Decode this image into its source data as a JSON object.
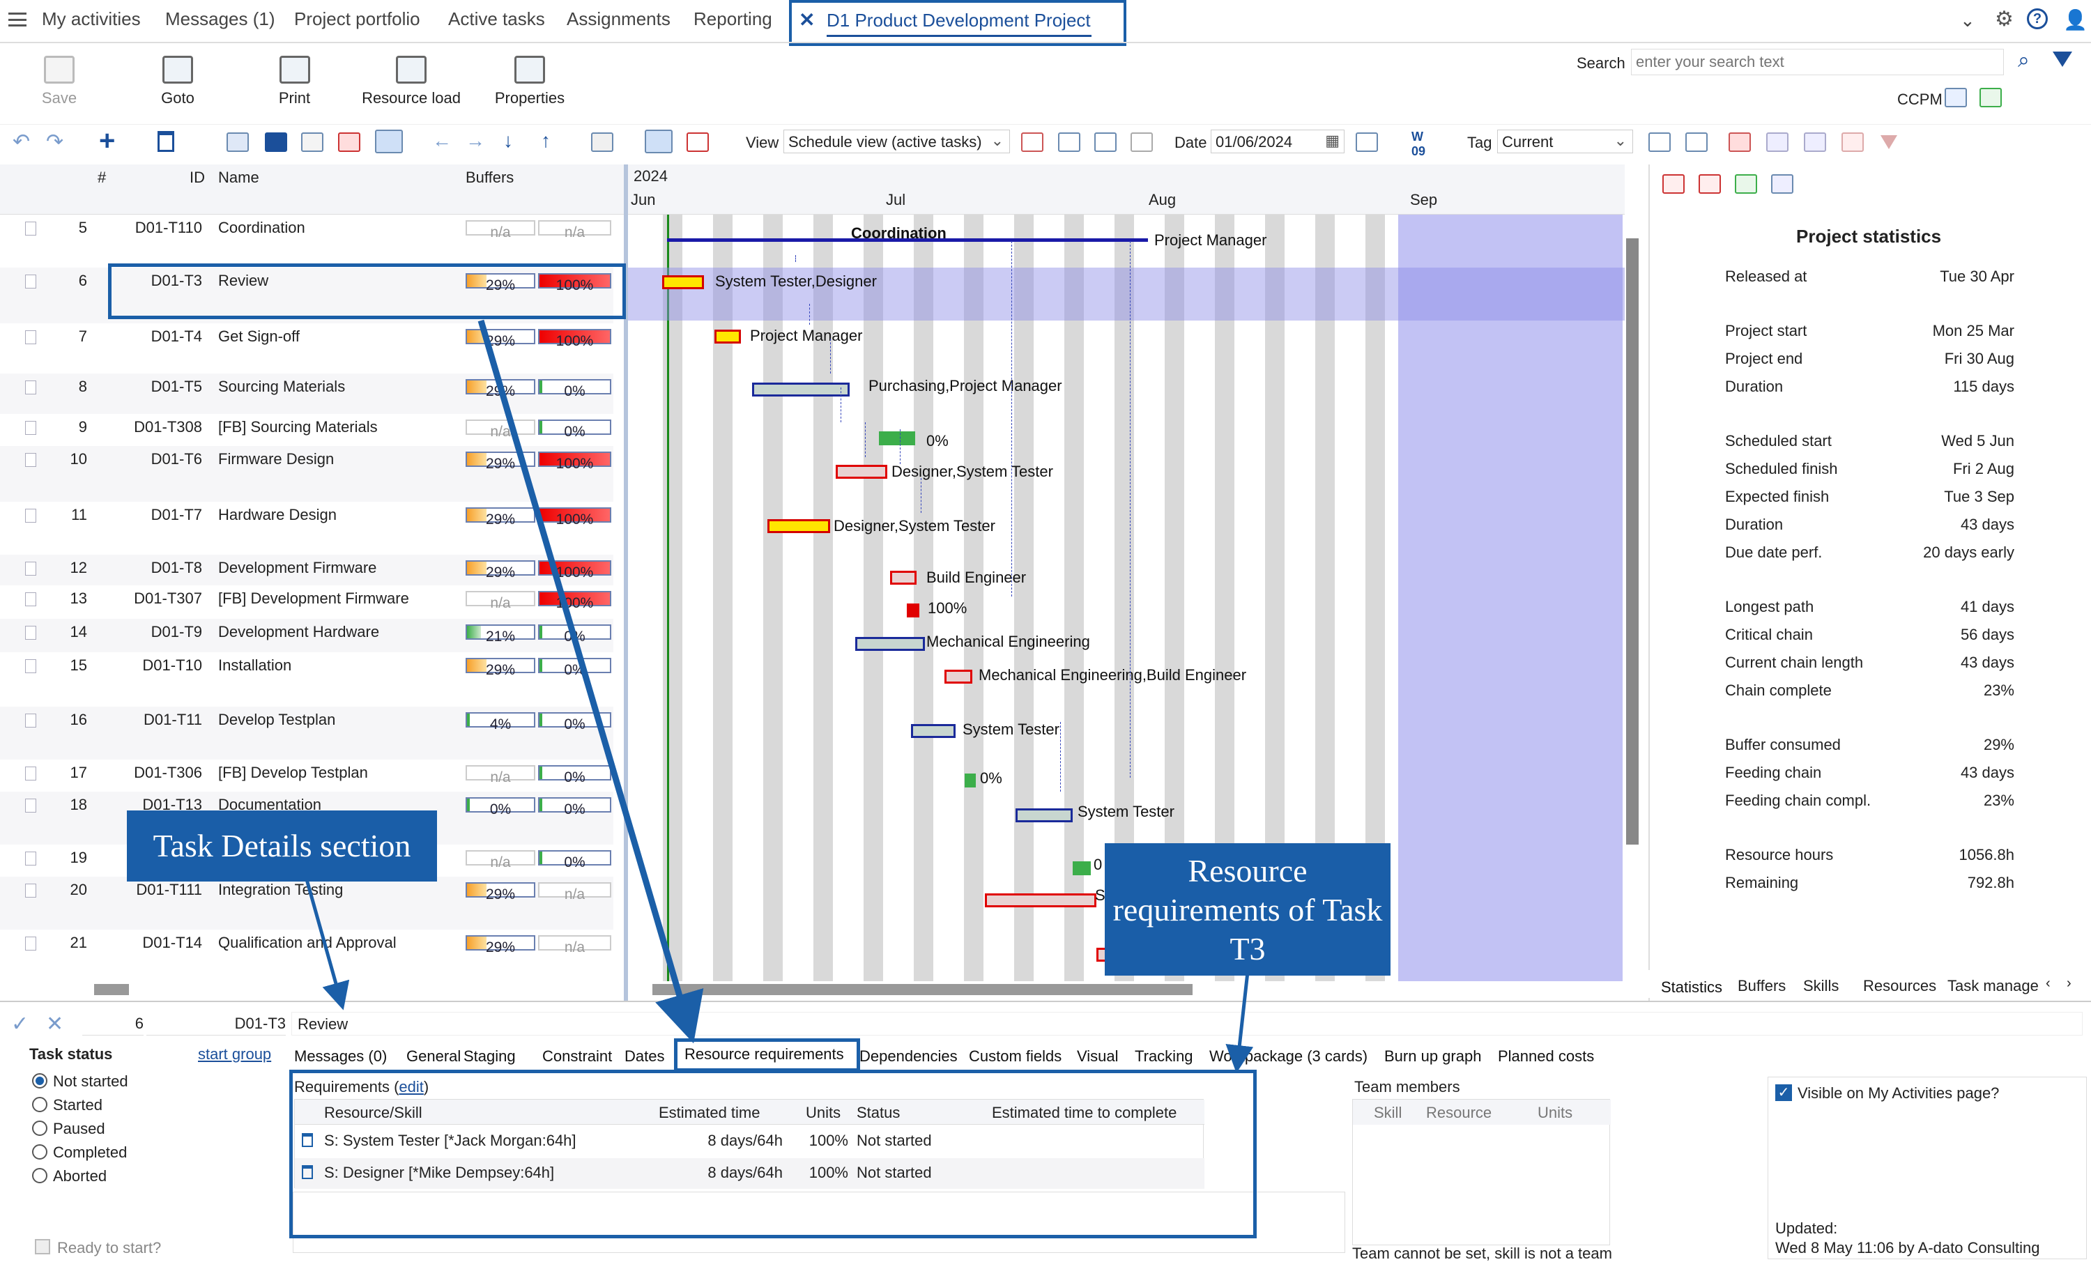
{
  "nav": {
    "tabs": [
      "My activities",
      "Messages (1)",
      "Project portfolio",
      "Active tasks",
      "Assignments",
      "Reporting"
    ],
    "active_tab": "D1 Product Development Project"
  },
  "search": {
    "label": "Search",
    "placeholder": "enter your search text"
  },
  "ccpm_label": "CCPM",
  "toolbar": {
    "save": "Save",
    "goto": "Goto",
    "print": "Print",
    "resource_load": "Resource load",
    "properties": "Properties"
  },
  "toolbar2": {
    "view_label": "View",
    "view_value": "Schedule view (active tasks)",
    "date_label": "Date",
    "date_value": "01/06/2024",
    "tag_label": "Tag",
    "tag_value": "Current"
  },
  "grid": {
    "headers": {
      "num": "#",
      "id": "ID",
      "name": "Name",
      "buffers": "Buffers"
    },
    "rows": [
      {
        "num": "5",
        "id": "D01-T110",
        "name": "Coordination",
        "b1": "n/a",
        "b2": "n/a"
      },
      {
        "num": "6",
        "id": "D01-T3",
        "name": "Review",
        "b1": "29%",
        "b2": "100%"
      },
      {
        "num": "7",
        "id": "D01-T4",
        "name": "Get Sign-off",
        "b1": "29%",
        "b2": "100%"
      },
      {
        "num": "8",
        "id": "D01-T5",
        "name": "Sourcing Materials",
        "b1": "29%",
        "b2": "0%"
      },
      {
        "num": "9",
        "id": "D01-T308",
        "name": "[FB]  Sourcing Materials",
        "b1": "n/a",
        "b2": "0%"
      },
      {
        "num": "10",
        "id": "D01-T6",
        "name": "Firmware Design",
        "b1": "29%",
        "b2": "100%"
      },
      {
        "num": "11",
        "id": "D01-T7",
        "name": "Hardware Design",
        "b1": "29%",
        "b2": "100%"
      },
      {
        "num": "12",
        "id": "D01-T8",
        "name": "Development Firmware",
        "b1": "29%",
        "b2": "100%"
      },
      {
        "num": "13",
        "id": "D01-T307",
        "name": "[FB]  Development Firmware",
        "b1": "n/a",
        "b2": "100%"
      },
      {
        "num": "14",
        "id": "D01-T9",
        "name": "Development Hardware",
        "b1": "21%",
        "b2": "0%"
      },
      {
        "num": "15",
        "id": "D01-T10",
        "name": "Installation",
        "b1": "29%",
        "b2": "0%"
      },
      {
        "num": "16",
        "id": "D01-T11",
        "name": "Develop Testplan",
        "b1": "4%",
        "b2": "0%"
      },
      {
        "num": "17",
        "id": "D01-T306",
        "name": "[FB]  Develop Testplan",
        "b1": "n/a",
        "b2": "0%"
      },
      {
        "num": "18",
        "id": "D01-T13",
        "name": "Documentation",
        "b1": "0%",
        "b2": "0%"
      },
      {
        "num": "19",
        "id": "",
        "name": "",
        "b1": "n/a",
        "b2": "0%"
      },
      {
        "num": "20",
        "id": "D01-T111",
        "name": "Integration Testing",
        "b1": "29%",
        "b2": "n/a"
      },
      {
        "num": "21",
        "id": "D01-T14",
        "name": "Qualification and Approval",
        "b1": "29%",
        "b2": "n/a"
      }
    ]
  },
  "gantt": {
    "year": "2024",
    "months": [
      "Jun",
      "Jul",
      "Aug",
      "Sep"
    ],
    "summary_title": "Coordination",
    "labels": [
      "Project Manager",
      "System Tester,Designer",
      "Project Manager",
      "Purchasing,Project Manager",
      "0%",
      "Designer,System Tester",
      "Designer,System Tester",
      "Build Engineer",
      "100%",
      "Mechanical Engineering",
      "Mechanical Engineering,Build Engineer",
      "System Tester",
      "0%",
      "System Tester",
      "0",
      "S"
    ]
  },
  "stats": {
    "title": "Project statistics",
    "items": [
      {
        "label": "Released at",
        "value": "Tue 30 Apr"
      },
      {
        "label": "Project start",
        "value": "Mon 25 Mar"
      },
      {
        "label": "Project end",
        "value": "Fri 30 Aug"
      },
      {
        "label": "Duration",
        "value": "115 days"
      },
      {
        "label": "Scheduled start",
        "value": "Wed 5 Jun"
      },
      {
        "label": "Scheduled finish",
        "value": "Fri 2 Aug"
      },
      {
        "label": "Expected finish",
        "value": "Tue 3 Sep"
      },
      {
        "label": "Duration",
        "value": "43 days"
      },
      {
        "label": "Due date perf.",
        "value": "20 days early"
      },
      {
        "label": "Longest path",
        "value": "41 days"
      },
      {
        "label": "Critical chain",
        "value": "56 days"
      },
      {
        "label": "Current chain length",
        "value": "43 days"
      },
      {
        "label": "Chain complete",
        "value": "23%"
      },
      {
        "label": "Buffer consumed",
        "value": "29%"
      },
      {
        "label": "Feeding chain",
        "value": "43 days"
      },
      {
        "label": "Feeding chain compl.",
        "value": "23%"
      },
      {
        "label": "Resource hours",
        "value": "1056.8h"
      },
      {
        "label": "Remaining",
        "value": "792.8h"
      }
    ],
    "tabs": [
      "Statistics",
      "Buffers",
      "Skills",
      "Resources",
      "Task manage"
    ]
  },
  "details": {
    "num": "6",
    "id": "D01-T3",
    "name": "Review",
    "task_status_title": "Task status",
    "start_group": "start group",
    "statuses": [
      "Not started",
      "Started",
      "Paused",
      "Completed",
      "Aborted"
    ],
    "ready": "Ready to start?",
    "tabs": [
      "Messages (0)",
      "General",
      "Staging",
      "Constraint",
      "Dates",
      "Resource requirements",
      "Dependencies",
      "Custom fields",
      "Visual",
      "Tracking",
      "Workpackage (3 cards)",
      "Burn up graph",
      "Planned costs"
    ],
    "req_label": "Requirements (",
    "req_edit": "edit",
    "req_close": ")",
    "req_headers": [
      "Resource/Skill",
      "Estimated time",
      "Units",
      "Status",
      "Estimated time to complete"
    ],
    "req_rows": [
      {
        "res": "S: System Tester [*Jack Morgan:64h]",
        "time": "8 days/64h",
        "units": "100%",
        "status": "Not started"
      },
      {
        "res": "S: Designer [*Mike Dempsey:64h]",
        "time": "8 days/64h",
        "units": "100%",
        "status": "Not started"
      }
    ],
    "team_title": "Team members",
    "team_headers": [
      "Skill",
      "Resource",
      "Units"
    ],
    "team_note": "Team cannot be set, skill is not a team",
    "visible_label": "Visible on My Activities page?",
    "updated_label": "Updated:",
    "updated_value": "Wed 8 May 11:06 by A-dato Consulting"
  },
  "callouts": {
    "task_details": "Task Details section",
    "resource_req": "Resource requirements of Task T3"
  }
}
